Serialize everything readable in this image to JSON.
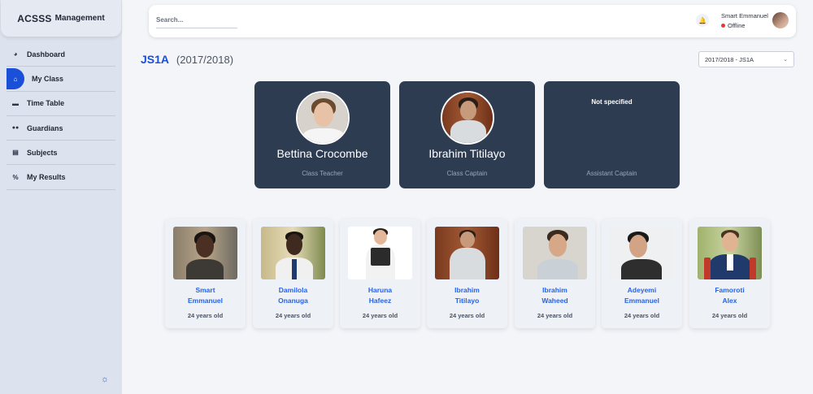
{
  "brand": {
    "name": "ACSSS",
    "suffix": "Management"
  },
  "sidebar": {
    "items": [
      {
        "label": "Dashboard",
        "icon": "dashboard-icon",
        "glyph": "◕",
        "active": false
      },
      {
        "label": "My Class",
        "icon": "home-icon",
        "glyph": "⌂",
        "active": true
      },
      {
        "label": "Time Table",
        "icon": "table-icon",
        "glyph": "▬",
        "active": false
      },
      {
        "label": "Guardians",
        "icon": "users-icon",
        "glyph": "👥",
        "active": false
      },
      {
        "label": "Subjects",
        "icon": "book-icon",
        "glyph": "▤",
        "active": false
      },
      {
        "label": "My Results",
        "icon": "percent-icon",
        "glyph": "%",
        "active": false
      }
    ]
  },
  "topbar": {
    "search_placeholder": "Search...",
    "user_name": "Smart Emmanuel",
    "user_status": "Offline"
  },
  "page": {
    "class_name": "JS1A",
    "class_year": "(2017/2018)",
    "session_select": "2017/2018 - JS1A"
  },
  "roles": [
    {
      "name": "Bettina Crocombe",
      "role": "Class Teacher"
    },
    {
      "name": "Ibrahim Titilayo",
      "role": "Class Captain"
    },
    {
      "name": "Not specified",
      "role": "Assistant Captain"
    }
  ],
  "students": [
    {
      "first": "Smart",
      "last": "Emmanuel",
      "age": "24 years old"
    },
    {
      "first": "Damilola",
      "last": "Onanuga",
      "age": "24 years old"
    },
    {
      "first": "Haruna",
      "last": "Hafeez",
      "age": "24 years old"
    },
    {
      "first": "Ibrahim",
      "last": "Titilayo",
      "age": "24 years old"
    },
    {
      "first": "Ibrahim",
      "last": "Waheed",
      "age": "24 years old"
    },
    {
      "first": "Adeyemi",
      "last": "Emmanuel",
      "age": "24 years old"
    },
    {
      "first": "Famoroti",
      "last": "Alex",
      "age": "24 years old"
    }
  ]
}
